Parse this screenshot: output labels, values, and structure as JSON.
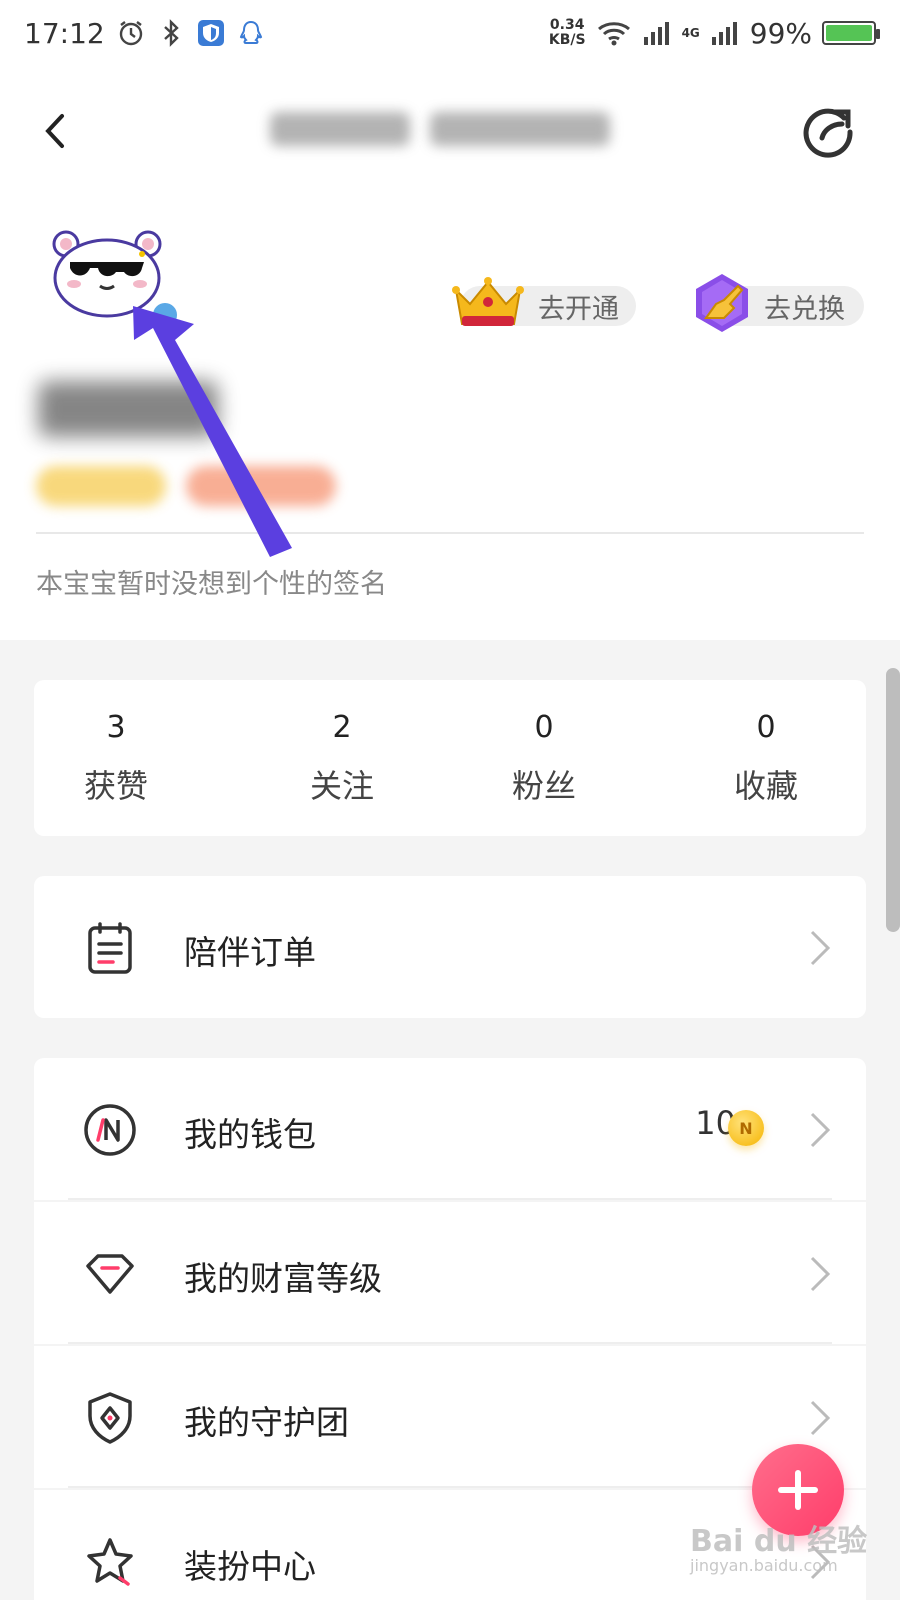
{
  "status_bar": {
    "time": "17:12",
    "net_speed_value": "0.34",
    "net_speed_unit": "KB/S",
    "network": "4G",
    "battery": "99%",
    "battery_level": 0.99
  },
  "profile": {
    "signature": "本宝宝暂时没想到个性的签名",
    "vip_label": "去开通",
    "exchange_label": "去兑换"
  },
  "stats": [
    {
      "value": "3",
      "label": "获赞"
    },
    {
      "value": "2",
      "label": "关注"
    },
    {
      "value": "0",
      "label": "粉丝"
    },
    {
      "value": "0",
      "label": "收藏"
    }
  ],
  "menu": {
    "orders": "陪伴订单",
    "wallet": "我的钱包",
    "wallet_value": "10",
    "coin_letter": "N",
    "wealth": "我的财富等级",
    "guard": "我的守护团",
    "dress": "装扮中心"
  },
  "watermark": {
    "brand": "Bai du 经验",
    "url": "jingyan.baidu.com"
  },
  "colors": {
    "accent": "#ff3d6a",
    "arrow": "#5b3fe0"
  }
}
